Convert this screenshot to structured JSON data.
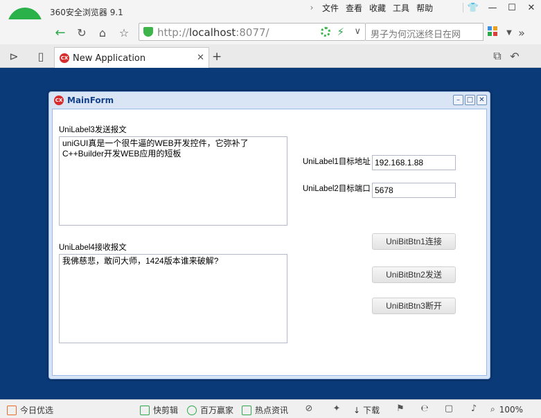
{
  "browser": {
    "app_title": "360安全浏览器 9.1",
    "menu": [
      "文件",
      "查看",
      "收藏",
      "工具",
      "帮助"
    ],
    "url_prefix": "http://",
    "url_host": "localhost",
    "url_port": ":8077/",
    "search_placeholder": "男子为何沉迷终日在网",
    "tab_title": "New Application",
    "tab_favicon": "CX"
  },
  "form": {
    "title": "MainForm",
    "favicon": "CX",
    "send_label": "UniLabel3发送报文",
    "send_text": "uniGUI真是一个很牛逼的WEB开发控件，它弥补了C++Builder开发WEB应用的短板",
    "recv_label": "UniLabel4接收报文",
    "recv_text": "我佛慈悲，敢问大师，1424版本谁来破解?",
    "addr_label": "UniLabel1目标地址",
    "addr_value": "192.168.1.88",
    "port_label": "UniLabel2目标端口",
    "port_value": "5678",
    "btn_connect": "UniBitBtn1连接",
    "btn_send": "UniBitBtn2发送",
    "btn_disconnect": "UniBitBtn3断开"
  },
  "statusbar": {
    "today": "今日优选",
    "clip": "快剪辑",
    "rich": "百万赢家",
    "news": "热点资讯",
    "download": "下载",
    "zoom": "100%"
  },
  "colors": {
    "page_bg": "#0b3a78",
    "form_title": "#15428b",
    "brand_green": "#2bb14a"
  }
}
